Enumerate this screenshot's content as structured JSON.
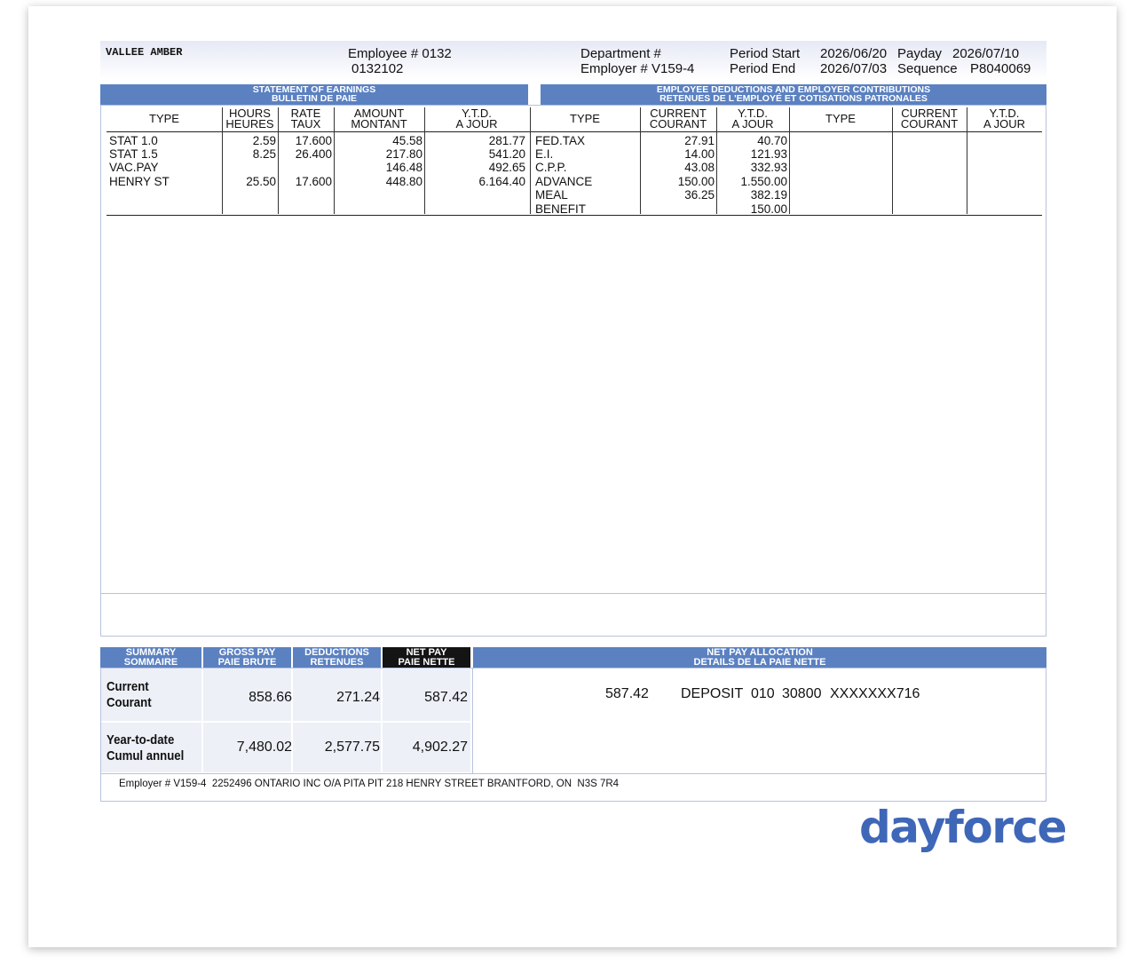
{
  "header": {
    "employee_name": "VALLEE AMBER",
    "employee_no": "Employee # 0132",
    "employee_id": "0132102",
    "department": "Department #",
    "employer": "Employer # V159-4",
    "period_start_label": "Period Start",
    "period_start": "2026/06/20",
    "period_end_label": "Period End",
    "period_end": "2026/07/03",
    "payday_label": "Payday",
    "payday": "2026/07/10",
    "sequence_label": "Sequence",
    "sequence": "P8040069"
  },
  "earnings": {
    "title1": "STATEMENT OF EARNINGS",
    "title2": "BULLETIN DE PAIE",
    "cols": {
      "type": "TYPE",
      "hours1": "HOURS",
      "hours2": "HEURES",
      "rate1": "RATE",
      "rate2": "TAUX",
      "amount1": "AMOUNT",
      "amount2": "MONTANT",
      "ytd1": "Y.T.D.",
      "ytd2": "A JOUR"
    },
    "rows": [
      {
        "type": "STAT 1.0",
        "hours": "2.59",
        "rate": "17.600",
        "amount": "45.58",
        "ytd": "281.77"
      },
      {
        "type": "STAT 1.5",
        "hours": "8.25",
        "rate": "26.400",
        "amount": "217.80",
        "ytd": "541.20"
      },
      {
        "type": "VAC.PAY",
        "hours": "",
        "rate": "",
        "amount": "146.48",
        "ytd": "492.65"
      },
      {
        "type": "HENRY ST",
        "hours": "25.50",
        "rate": "17.600",
        "amount": "448.80",
        "ytd": "6.164.40"
      }
    ]
  },
  "deductions": {
    "title1": "EMPLOYEE DEDUCTIONS AND EMPLOYER CONTRIBUTIONS",
    "title2": "RETENUES DE L'EMPLOYÉ ET COTISATIONS PATRONALES",
    "cols": {
      "type": "TYPE",
      "current1": "CURRENT",
      "current2": "COURANT",
      "ytd1": "Y.T.D.",
      "ytd2": "A JOUR",
      "type_b": "TYPE",
      "current1_b": "CURRENT",
      "current2_b": "COURANT",
      "ytd1_b": "Y.T.D.",
      "ytd2_b": "A JOUR"
    },
    "rows": [
      {
        "type": "FED.TAX",
        "current": "27.91",
        "ytd": "40.70"
      },
      {
        "type": "E.I.",
        "current": "14.00",
        "ytd": "121.93"
      },
      {
        "type": "C.P.P.",
        "current": "43.08",
        "ytd": "332.93"
      },
      {
        "type": "ADVANCE",
        "current": "150.00",
        "ytd": "1.550.00"
      },
      {
        "type": "MEAL",
        "current": "36.25",
        "ytd": "382.19"
      },
      {
        "type": "BENEFIT",
        "current": "",
        "ytd": "150.00"
      }
    ]
  },
  "summary": {
    "h_summary1": "SUMMARY",
    "h_summary2": "SOMMAIRE",
    "h_gross1": "GROSS PAY",
    "h_gross2": "PAIE BRUTE",
    "h_ded1": "DEDUCTIONS",
    "h_ded2": "RETENUES",
    "h_net1": "NET PAY",
    "h_net2": "PAIE NETTE",
    "h_alloc1": "NET PAY ALLOCATION",
    "h_alloc2": "DETAILS DE LA PAIE NETTE",
    "current_label1": "Current",
    "current_label2": "Courant",
    "ytd_label1": "Year-to-date",
    "ytd_label2": "Cumul annuel",
    "current": {
      "gross": "858.66",
      "deductions": "271.24",
      "net": "587.42"
    },
    "ytd": {
      "gross": "7,480.02",
      "deductions": "2,577.75",
      "net": "4,902.27"
    },
    "allocation": {
      "amount": "587.42",
      "method": "DEPOSIT",
      "transit": "010",
      "institution": "30800",
      "account": "XXXXXXX716"
    }
  },
  "footer": {
    "employer_line": "Employer # V159-4  2252496 ONTARIO INC O/A PITA PIT 218 HENRY STREET BRANTFORD, ON  N3S 7R4"
  },
  "brand": {
    "logo_text": "dayforce",
    "color": "#3f67b8"
  }
}
